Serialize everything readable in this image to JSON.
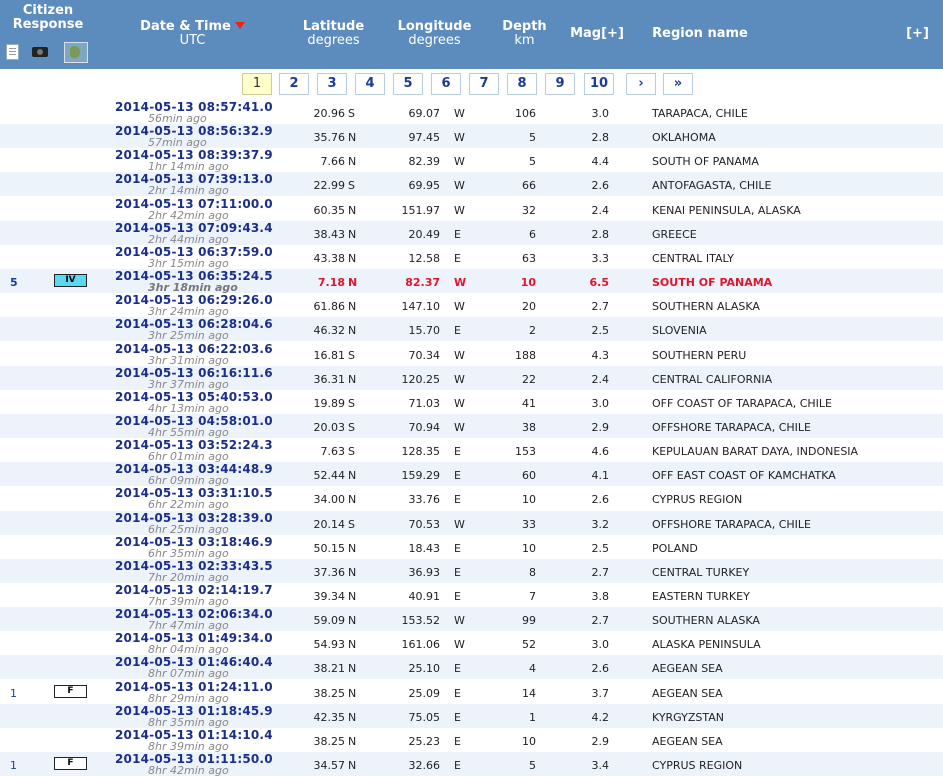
{
  "header": {
    "citizen_response": "Citizen Response",
    "date_time": "Date & Time",
    "date_time_unit": "UTC",
    "latitude": "Latitude",
    "latitude_unit": "degrees",
    "longitude": "Longitude",
    "longitude_unit": "degrees",
    "depth": "Depth",
    "depth_unit": "km",
    "mag": "Mag[+]",
    "region": "Region name",
    "expand": "[+]"
  },
  "pager": [
    "1",
    "2",
    "3",
    "4",
    "5",
    "6",
    "7",
    "8",
    "9",
    "10",
    "›",
    "»"
  ],
  "highlight_color": "#e0142b",
  "rows": [
    {
      "cnt": "",
      "intensity": "",
      "dt": "2014-05-13   08:57:41.0",
      "ago": "56min ago",
      "lat": "20.96",
      "ns": "S",
      "lon": "69.07",
      "ew": "W",
      "depth": "106",
      "mag": "3.0",
      "region": "TARAPACA, CHILE"
    },
    {
      "cnt": "",
      "intensity": "",
      "dt": "2014-05-13   08:56:32.9",
      "ago": "57min ago",
      "lat": "35.76",
      "ns": "N",
      "lon": "97.45",
      "ew": "W",
      "depth": "5",
      "mag": "2.8",
      "region": "OKLAHOMA"
    },
    {
      "cnt": "",
      "intensity": "",
      "dt": "2014-05-13   08:39:37.9",
      "ago": "1hr 14min ago",
      "lat": "7.66",
      "ns": "N",
      "lon": "82.39",
      "ew": "W",
      "depth": "5",
      "mag": "4.4",
      "region": "SOUTH OF PANAMA"
    },
    {
      "cnt": "",
      "intensity": "",
      "dt": "2014-05-13   07:39:13.0",
      "ago": "2hr 14min ago",
      "lat": "22.99",
      "ns": "S",
      "lon": "69.95",
      "ew": "W",
      "depth": "66",
      "mag": "2.6",
      "region": "ANTOFAGASTA, CHILE"
    },
    {
      "cnt": "",
      "intensity": "",
      "dt": "2014-05-13   07:11:00.0",
      "ago": "2hr 42min ago",
      "lat": "60.35",
      "ns": "N",
      "lon": "151.97",
      "ew": "W",
      "depth": "32",
      "mag": "2.4",
      "region": "KENAI PENINSULA, ALASKA"
    },
    {
      "cnt": "",
      "intensity": "",
      "dt": "2014-05-13   07:09:43.4",
      "ago": "2hr 44min ago",
      "lat": "38.43",
      "ns": "N",
      "lon": "20.49",
      "ew": "E",
      "depth": "6",
      "mag": "2.8",
      "region": "GREECE"
    },
    {
      "cnt": "",
      "intensity": "",
      "dt": "2014-05-13   06:37:59.0",
      "ago": "3hr 15min ago",
      "lat": "43.38",
      "ns": "N",
      "lon": "12.58",
      "ew": "E",
      "depth": "63",
      "mag": "3.3",
      "region": "CENTRAL ITALY"
    },
    {
      "cnt": "5",
      "intensity": "IV",
      "dt": "2014-05-13   06:35:24.5",
      "ago": "3hr 18min ago",
      "lat": "7.18",
      "ns": "N",
      "lon": "82.37",
      "ew": "W",
      "depth": "10",
      "mag": "6.5",
      "region": "SOUTH OF PANAMA",
      "hl": true
    },
    {
      "cnt": "",
      "intensity": "",
      "dt": "2014-05-13   06:29:26.0",
      "ago": "3hr 24min ago",
      "lat": "61.86",
      "ns": "N",
      "lon": "147.10",
      "ew": "W",
      "depth": "20",
      "mag": "2.7",
      "region": "SOUTHERN ALASKA"
    },
    {
      "cnt": "",
      "intensity": "",
      "dt": "2014-05-13   06:28:04.6",
      "ago": "3hr 25min ago",
      "lat": "46.32",
      "ns": "N",
      "lon": "15.70",
      "ew": "E",
      "depth": "2",
      "mag": "2.5",
      "region": "SLOVENIA"
    },
    {
      "cnt": "",
      "intensity": "",
      "dt": "2014-05-13   06:22:03.6",
      "ago": "3hr 31min ago",
      "lat": "16.81",
      "ns": "S",
      "lon": "70.34",
      "ew": "W",
      "depth": "188",
      "mag": "4.3",
      "region": "SOUTHERN PERU"
    },
    {
      "cnt": "",
      "intensity": "",
      "dt": "2014-05-13   06:16:11.6",
      "ago": "3hr 37min ago",
      "lat": "36.31",
      "ns": "N",
      "lon": "120.25",
      "ew": "W",
      "depth": "22",
      "mag": "2.4",
      "region": "CENTRAL CALIFORNIA"
    },
    {
      "cnt": "",
      "intensity": "",
      "dt": "2014-05-13   05:40:53.0",
      "ago": "4hr 13min ago",
      "lat": "19.89",
      "ns": "S",
      "lon": "71.03",
      "ew": "W",
      "depth": "41",
      "mag": "3.0",
      "region": "OFF COAST OF TARAPACA, CHILE"
    },
    {
      "cnt": "",
      "intensity": "",
      "dt": "2014-05-13   04:58:01.0",
      "ago": "4hr 55min ago",
      "lat": "20.03",
      "ns": "S",
      "lon": "70.94",
      "ew": "W",
      "depth": "38",
      "mag": "2.9",
      "region": "OFFSHORE TARAPACA, CHILE"
    },
    {
      "cnt": "",
      "intensity": "",
      "dt": "2014-05-13   03:52:24.3",
      "ago": "6hr 01min ago",
      "lat": "7.63",
      "ns": "S",
      "lon": "128.35",
      "ew": "E",
      "depth": "153",
      "mag": "4.6",
      "region": "KEPULAUAN BARAT DAYA, INDONESIA"
    },
    {
      "cnt": "",
      "intensity": "",
      "dt": "2014-05-13   03:44:48.9",
      "ago": "6hr 09min ago",
      "lat": "52.44",
      "ns": "N",
      "lon": "159.29",
      "ew": "E",
      "depth": "60",
      "mag": "4.1",
      "region": "OFF EAST COAST OF KAMCHATKA"
    },
    {
      "cnt": "",
      "intensity": "",
      "dt": "2014-05-13   03:31:10.5",
      "ago": "6hr 22min ago",
      "lat": "34.00",
      "ns": "N",
      "lon": "33.76",
      "ew": "E",
      "depth": "10",
      "mag": "2.6",
      "region": "CYPRUS REGION"
    },
    {
      "cnt": "",
      "intensity": "",
      "dt": "2014-05-13   03:28:39.0",
      "ago": "6hr 25min ago",
      "lat": "20.14",
      "ns": "S",
      "lon": "70.53",
      "ew": "W",
      "depth": "33",
      "mag": "3.2",
      "region": "OFFSHORE TARAPACA, CHILE"
    },
    {
      "cnt": "",
      "intensity": "",
      "dt": "2014-05-13   03:18:46.9",
      "ago": "6hr 35min ago",
      "lat": "50.15",
      "ns": "N",
      "lon": "18.43",
      "ew": "E",
      "depth": "10",
      "mag": "2.5",
      "region": "POLAND"
    },
    {
      "cnt": "",
      "intensity": "",
      "dt": "2014-05-13   02:33:43.5",
      "ago": "7hr 20min ago",
      "lat": "37.36",
      "ns": "N",
      "lon": "36.93",
      "ew": "E",
      "depth": "8",
      "mag": "2.7",
      "region": "CENTRAL TURKEY"
    },
    {
      "cnt": "",
      "intensity": "",
      "dt": "2014-05-13   02:14:19.7",
      "ago": "7hr 39min ago",
      "lat": "39.34",
      "ns": "N",
      "lon": "40.91",
      "ew": "E",
      "depth": "7",
      "mag": "3.8",
      "region": "EASTERN TURKEY"
    },
    {
      "cnt": "",
      "intensity": "",
      "dt": "2014-05-13   02:06:34.0",
      "ago": "7hr 47min ago",
      "lat": "59.09",
      "ns": "N",
      "lon": "153.52",
      "ew": "W",
      "depth": "99",
      "mag": "2.7",
      "region": "SOUTHERN ALASKA"
    },
    {
      "cnt": "",
      "intensity": "",
      "dt": "2014-05-13   01:49:34.0",
      "ago": "8hr 04min ago",
      "lat": "54.93",
      "ns": "N",
      "lon": "161.06",
      "ew": "W",
      "depth": "52",
      "mag": "3.0",
      "region": "ALASKA PENINSULA"
    },
    {
      "cnt": "",
      "intensity": "",
      "dt": "2014-05-13   01:46:40.4",
      "ago": "8hr 07min ago",
      "lat": "38.21",
      "ns": "N",
      "lon": "25.10",
      "ew": "E",
      "depth": "4",
      "mag": "2.6",
      "region": "AEGEAN SEA"
    },
    {
      "cnt": "1",
      "intensity": "F",
      "dt": "2014-05-13   01:24:11.0",
      "ago": "8hr 29min ago",
      "lat": "38.25",
      "ns": "N",
      "lon": "25.09",
      "ew": "E",
      "depth": "14",
      "mag": "3.7",
      "region": "AEGEAN SEA"
    },
    {
      "cnt": "",
      "intensity": "",
      "dt": "2014-05-13   01:18:45.9",
      "ago": "8hr 35min ago",
      "lat": "42.35",
      "ns": "N",
      "lon": "75.05",
      "ew": "E",
      "depth": "1",
      "mag": "4.2",
      "region": "KYRGYZSTAN"
    },
    {
      "cnt": "",
      "intensity": "",
      "dt": "2014-05-13   01:14:10.4",
      "ago": "8hr 39min ago",
      "lat": "38.25",
      "ns": "N",
      "lon": "25.23",
      "ew": "E",
      "depth": "10",
      "mag": "2.9",
      "region": "AEGEAN SEA"
    },
    {
      "cnt": "1",
      "intensity": "F",
      "dt": "2014-05-13   01:11:50.0",
      "ago": "8hr 42min ago",
      "lat": "34.57",
      "ns": "N",
      "lon": "32.66",
      "ew": "E",
      "depth": "5",
      "mag": "3.4",
      "region": "CYPRUS REGION"
    }
  ]
}
